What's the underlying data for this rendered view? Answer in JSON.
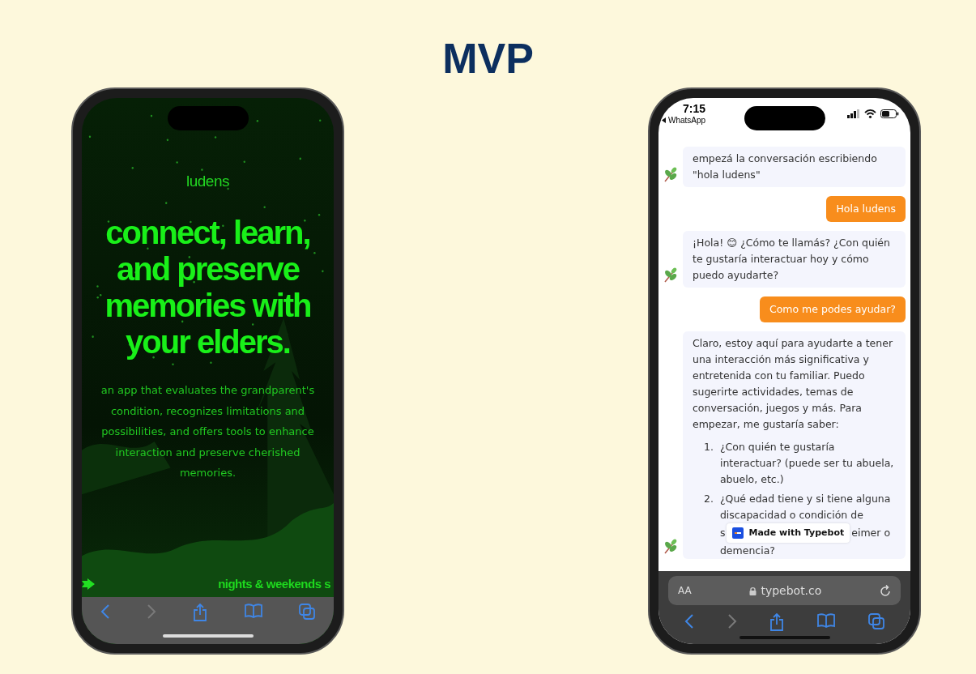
{
  "title": "MVP",
  "landing": {
    "brand": "ludens",
    "headline": "connect, learn, and preserve memories with your elders.",
    "description": "an app that evaluates the grandparent's condition, recognizes limitations and possibilities, and offers tools to enhance interaction and preserve cherished memories.",
    "footer": "nights & weekends s",
    "toolbar": [
      {
        "kind": "back",
        "disabled": false
      },
      {
        "kind": "forward",
        "disabled": true
      },
      {
        "kind": "share",
        "disabled": false
      },
      {
        "kind": "bookmarks",
        "disabled": false
      },
      {
        "kind": "tabs",
        "disabled": false
      }
    ]
  },
  "chat": {
    "time": "7:15",
    "back_app": "WhatsApp",
    "messages": [
      {
        "kind": "bot_text",
        "text": "empezá la conversación escribiendo \"hola ludens\""
      },
      {
        "kind": "user_text",
        "text": "Hola ludens"
      },
      {
        "kind": "bot_text",
        "text": "¡Hola! 😊 ¿Cómo te llamás? ¿Con quién te gustaría interactuar hoy y cómo puedo ayudarte?"
      },
      {
        "kind": "user_text",
        "text": "Como me podes ayudar?"
      },
      {
        "kind": "bot_list",
        "text": "Claro, estoy aquí para ayudarte a tener una interacción más significativa y entretenida con tu familiar. Puedo sugerirte actividades, temas de conversación, juegos y más. Para empezar, me gustaría saber:",
        "items": [
          {
            "number": "1.",
            "text": "¿Con quién te gustaría interactuar? (puede ser tu abuela, abuelo, etc.)"
          },
          {
            "number": "2.",
            "text": "¿Qué edad tiene y si tiene alguna discapacidad o condición de",
            "covered": [
              "s",
              "eimer o"
            ],
            "tail": "demencia?"
          }
        ]
      }
    ],
    "badge": "Made with Typebot",
    "address": {
      "text_size": "AA",
      "url": "typebot.co"
    },
    "toolbar": [
      {
        "kind": "back",
        "disabled": false
      },
      {
        "kind": "forward",
        "disabled": true
      },
      {
        "kind": "share",
        "disabled": false
      },
      {
        "kind": "bookmarks",
        "disabled": false
      },
      {
        "kind": "tabs",
        "disabled": false
      }
    ]
  }
}
